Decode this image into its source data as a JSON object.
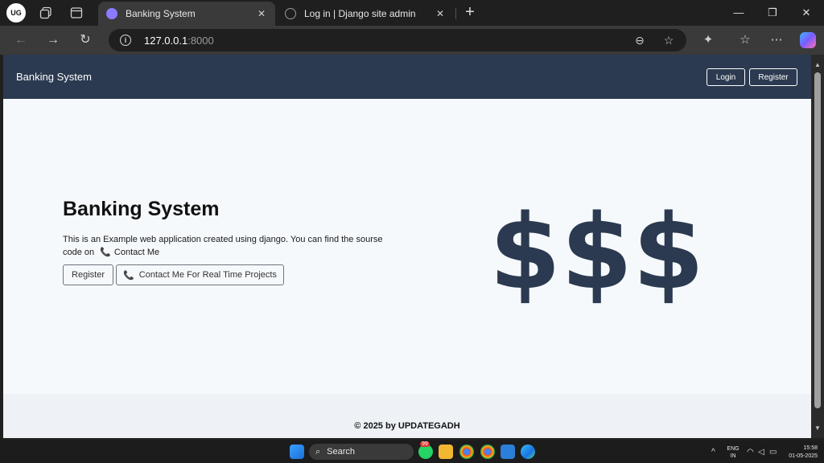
{
  "browser": {
    "profile_label": "UG",
    "tabs": [
      {
        "title": "Banking System",
        "active": true,
        "favicon_color": "#8a7cff"
      },
      {
        "title": "Log in | Django site admin",
        "active": false,
        "favicon_color": "#9a9a9a"
      }
    ],
    "address": {
      "host": "127.0.0.1",
      "port": ":8000"
    },
    "icons": {
      "back": "arrow-left-icon",
      "forward": "arrow-right-icon",
      "reload": "reload-icon",
      "site_info": "info-icon",
      "zoom": "zoom-icon",
      "favorite": "star-icon",
      "extensions": "puzzle-icon",
      "favorites": "favorites-icon",
      "menu": "ellipsis-icon",
      "copilot": "copilot-icon"
    }
  },
  "site": {
    "navbar": {
      "brand": "Banking System",
      "login_label": "Login",
      "register_label": "Register",
      "bg_color": "#2b3a50"
    },
    "hero": {
      "title": "Banking System",
      "text_before": "This is an Example web application created using django. You can find the sourse code on",
      "contact_link": "Contact Me",
      "register_button": "Register",
      "contact_button": "Contact Me For Real Time Projects",
      "dollar_art": "$$$",
      "dollar_color": "#2b3a50",
      "phone_color": "#d8333a"
    },
    "footer": {
      "text": "© 2025 by UPDATEGADH"
    }
  },
  "taskbar": {
    "search_label": "Search",
    "whatsapp_badge": "99",
    "lang_line1": "ENG",
    "lang_line2": "IN",
    "time": "15:58",
    "date": "01-05-2025"
  }
}
